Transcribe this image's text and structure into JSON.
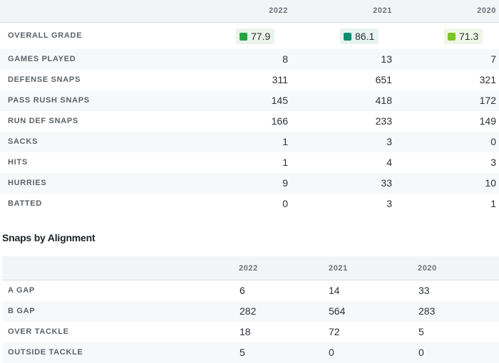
{
  "stats": {
    "years": [
      "2022",
      "2021",
      "2020"
    ],
    "grade": {
      "label": "OVERALL GRADE",
      "values": [
        {
          "value": "77.9",
          "color": "#27a243"
        },
        {
          "value": "86.1",
          "color": "#0f8c72"
        },
        {
          "value": "71.3",
          "color": "#7cc42a"
        }
      ]
    },
    "rows": [
      {
        "label": "GAMES PLAYED",
        "values": [
          "8",
          "13",
          "7"
        ]
      },
      {
        "label": "DEFENSE SNAPS",
        "values": [
          "311",
          "651",
          "321"
        ]
      },
      {
        "label": "PASS RUSH SNAPS",
        "values": [
          "145",
          "418",
          "172"
        ]
      },
      {
        "label": "RUN DEF SNAPS",
        "values": [
          "166",
          "233",
          "149"
        ]
      },
      {
        "label": "SACKS",
        "values": [
          "1",
          "3",
          "0"
        ]
      },
      {
        "label": "HITS",
        "values": [
          "1",
          "4",
          "3"
        ]
      },
      {
        "label": "HURRIES",
        "values": [
          "9",
          "33",
          "10"
        ]
      },
      {
        "label": "BATTED",
        "values": [
          "0",
          "3",
          "1"
        ]
      }
    ]
  },
  "alignment": {
    "title": "Snaps by Alignment",
    "years": [
      "2022",
      "2021",
      "2020"
    ],
    "rows": [
      {
        "label": "A GAP",
        "values": [
          "6",
          "14",
          "33"
        ]
      },
      {
        "label": "B GAP",
        "values": [
          "282",
          "564",
          "283"
        ]
      },
      {
        "label": "OVER TACKLE",
        "values": [
          "18",
          "72",
          "5"
        ]
      },
      {
        "label": "OUTSIDE TACKLE",
        "values": [
          "5",
          "0",
          "0"
        ]
      }
    ]
  }
}
